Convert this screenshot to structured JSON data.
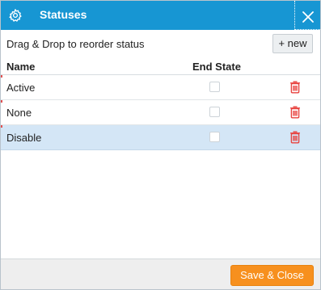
{
  "dialog": {
    "title": "Statuses",
    "hint": "Drag & Drop to reorder status",
    "new_label": "+ new",
    "save_label": "Save & Close"
  },
  "table": {
    "columns": [
      "Name",
      "End State"
    ],
    "rows": [
      {
        "name": "Active",
        "end_state": false,
        "selected": false
      },
      {
        "name": "None",
        "end_state": false,
        "selected": false
      },
      {
        "name": "Disable",
        "end_state": false,
        "selected": true
      }
    ]
  },
  "icons": {
    "settings": "gear-icon",
    "close": "close-icon",
    "delete": "trash-icon"
  },
  "colors": {
    "titlebar": "#1796d3",
    "selected_row": "#d4e6f6",
    "delete_icon": "#e8423e",
    "primary_button": "#f7901e"
  }
}
